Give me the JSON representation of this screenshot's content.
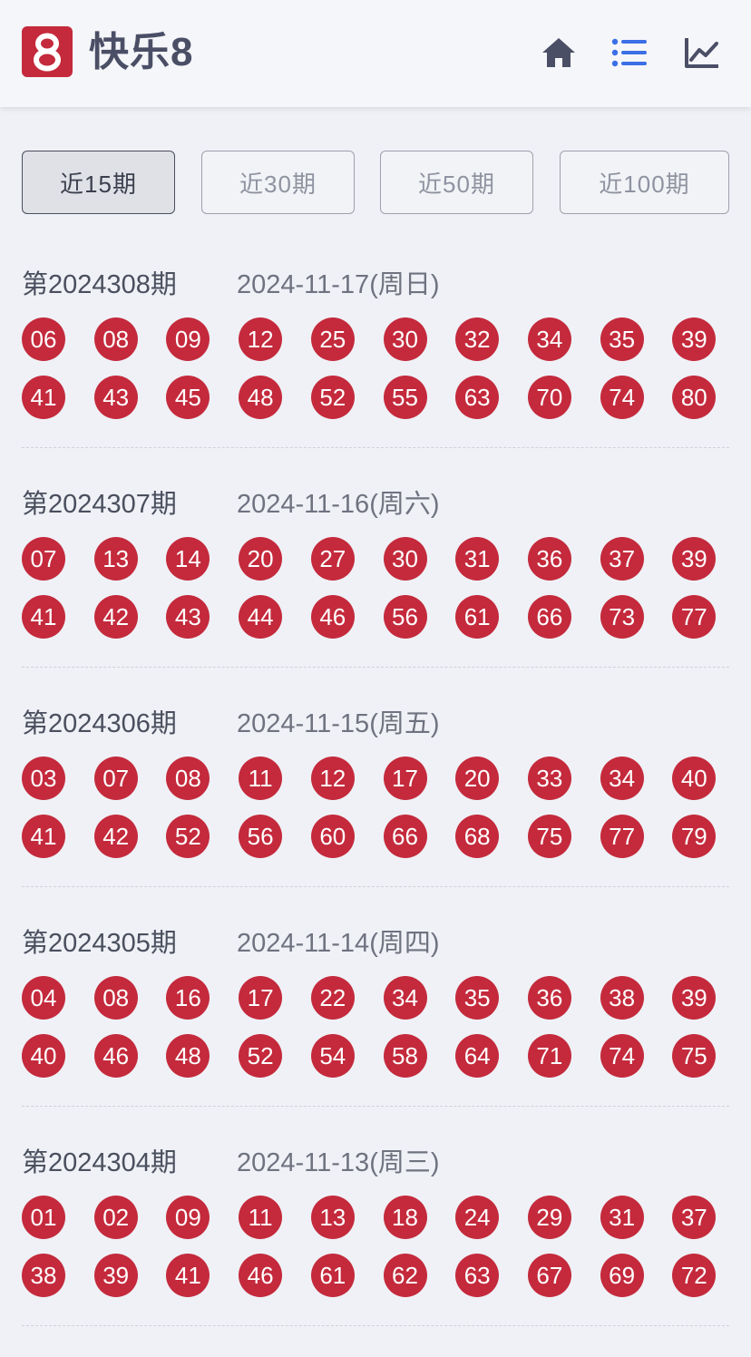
{
  "header": {
    "logo_text": "8",
    "title": "快乐8",
    "icons": [
      "home-icon",
      "list-icon",
      "chart-icon"
    ],
    "accent_color": "#c42a3c",
    "active_icon_color": "#3b6fe6"
  },
  "tabs": [
    {
      "label": "近15期",
      "active": true
    },
    {
      "label": "近30期",
      "active": false
    },
    {
      "label": "近50期",
      "active": false
    },
    {
      "label": "近100期",
      "active": false
    }
  ],
  "draws": [
    {
      "period": "第2024308期",
      "date": "2024-11-17(周日)",
      "numbers": [
        "06",
        "08",
        "09",
        "12",
        "25",
        "30",
        "32",
        "34",
        "35",
        "39",
        "41",
        "43",
        "45",
        "48",
        "52",
        "55",
        "63",
        "70",
        "74",
        "80"
      ]
    },
    {
      "period": "第2024307期",
      "date": "2024-11-16(周六)",
      "numbers": [
        "07",
        "13",
        "14",
        "20",
        "27",
        "30",
        "31",
        "36",
        "37",
        "39",
        "41",
        "42",
        "43",
        "44",
        "46",
        "56",
        "61",
        "66",
        "73",
        "77"
      ]
    },
    {
      "period": "第2024306期",
      "date": "2024-11-15(周五)",
      "numbers": [
        "03",
        "07",
        "08",
        "11",
        "12",
        "17",
        "20",
        "33",
        "34",
        "40",
        "41",
        "42",
        "52",
        "56",
        "60",
        "66",
        "68",
        "75",
        "77",
        "79"
      ]
    },
    {
      "period": "第2024305期",
      "date": "2024-11-14(周四)",
      "numbers": [
        "04",
        "08",
        "16",
        "17",
        "22",
        "34",
        "35",
        "36",
        "38",
        "39",
        "40",
        "46",
        "48",
        "52",
        "54",
        "58",
        "64",
        "71",
        "74",
        "75"
      ]
    },
    {
      "period": "第2024304期",
      "date": "2024-11-13(周三)",
      "numbers": [
        "01",
        "02",
        "09",
        "11",
        "13",
        "18",
        "24",
        "29",
        "31",
        "37",
        "38",
        "39",
        "41",
        "46",
        "61",
        "62",
        "63",
        "67",
        "69",
        "72"
      ]
    }
  ]
}
